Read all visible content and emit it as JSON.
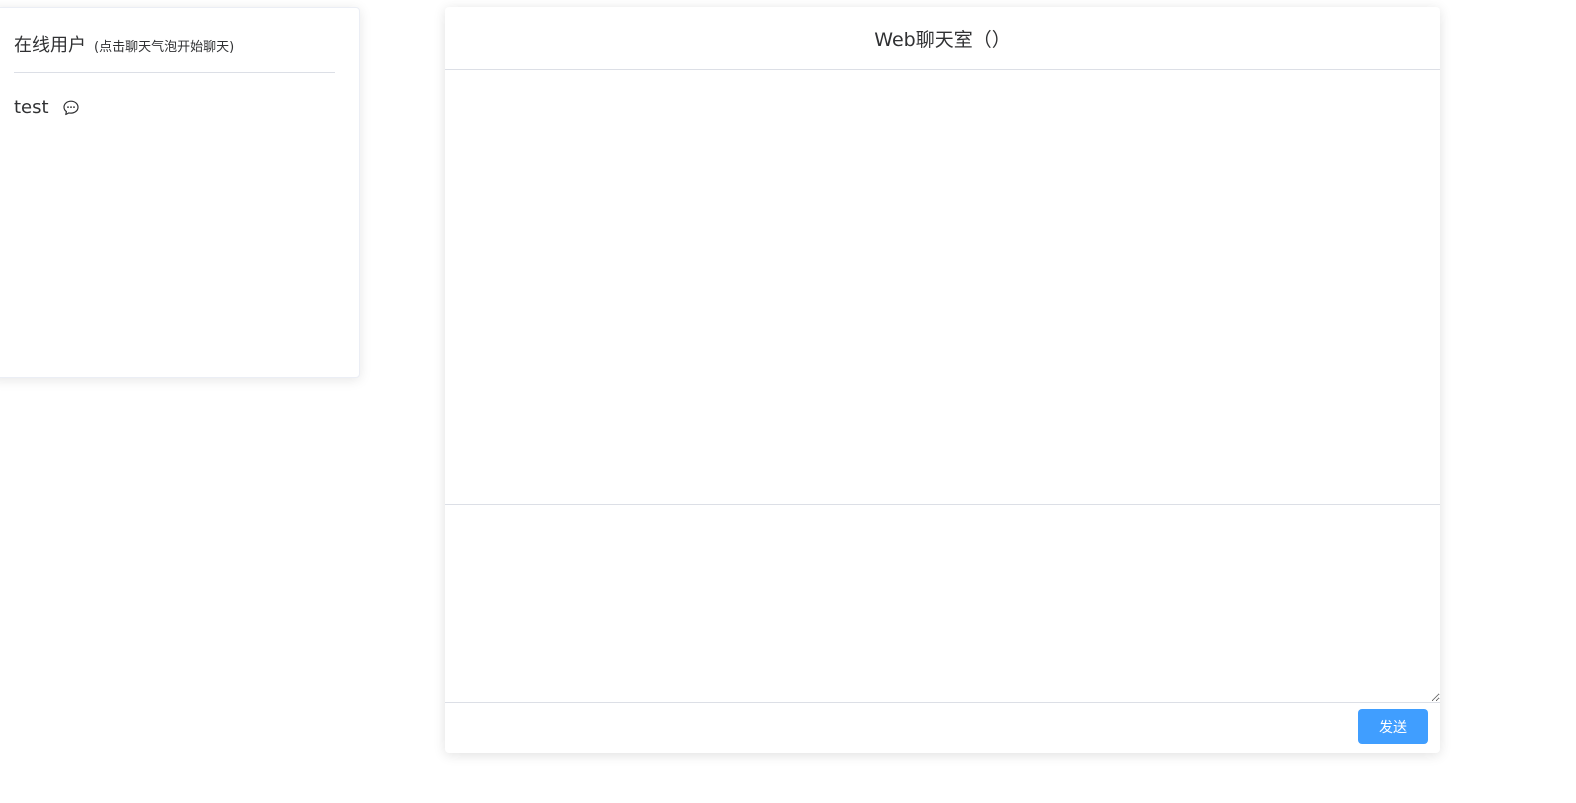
{
  "online_users": {
    "title": "在线用户",
    "hint": "(点击聊天气泡开始聊天)",
    "users": [
      {
        "name": "test",
        "icon": "chat-bubble-icon"
      }
    ]
  },
  "chat_room": {
    "title": "Web聊天室（）",
    "composer": {
      "value": "",
      "placeholder": ""
    },
    "send_label": "发送"
  },
  "colors": {
    "primary": "#409eff",
    "border": "#dcdfe6",
    "text": "#303133"
  }
}
